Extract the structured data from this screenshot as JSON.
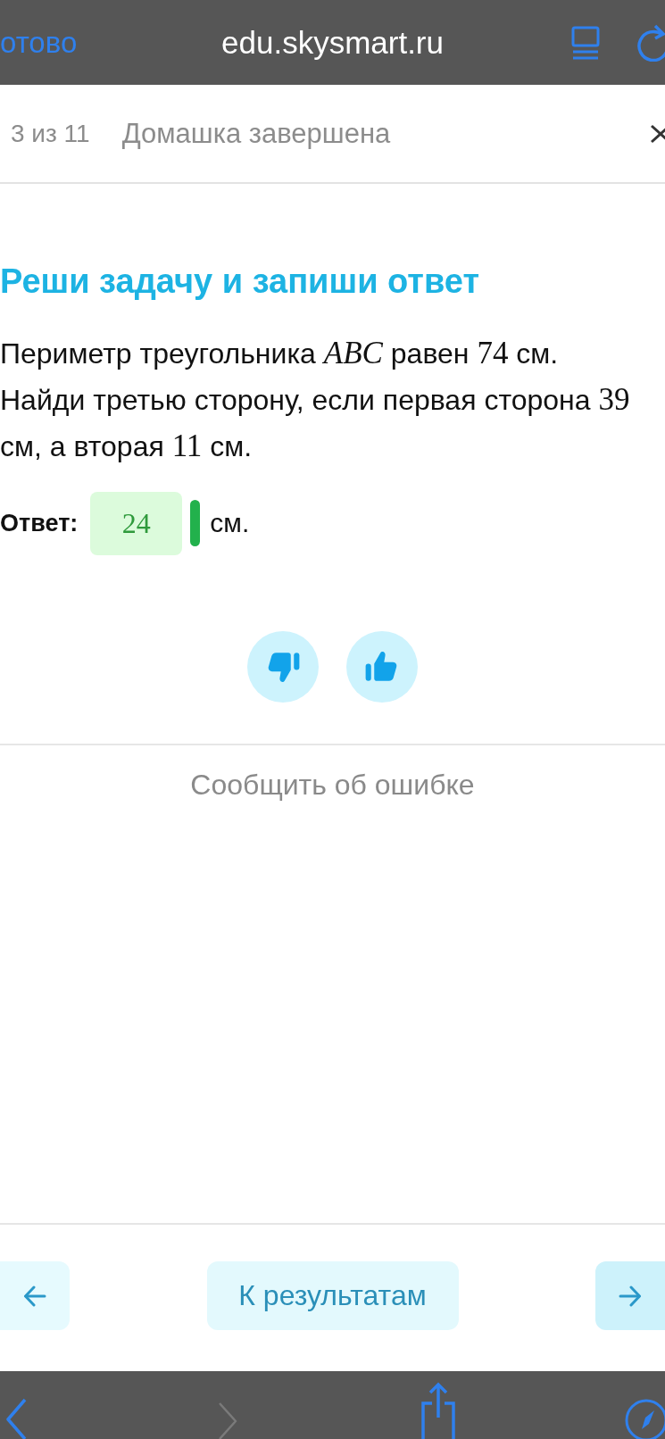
{
  "browser_bar": {
    "done": "отово",
    "url": "edu.skysmart.ru"
  },
  "header": {
    "progress": "3 из 11",
    "status": "Домашка завершена"
  },
  "task": {
    "title": "Реши задачу и запиши ответ",
    "lines": [
      [
        {
          "kind": "text",
          "text": "Периметр треугольника "
        },
        {
          "kind": "math",
          "text": "*ABC*"
        },
        {
          "kind": "text",
          "text": " равен "
        },
        {
          "kind": "math",
          "text": "74"
        },
        {
          "kind": "text",
          "text": " см."
        }
      ],
      [
        {
          "kind": "text",
          "text": "Найди третью сторону, если первая сторона "
        },
        {
          "kind": "math",
          "text": "39"
        }
      ],
      [
        {
          "kind": "text",
          "text": "см, а вторая "
        },
        {
          "kind": "math",
          "text": "11"
        },
        {
          "kind": "text",
          "text": " см."
        }
      ]
    ],
    "answer": {
      "label": "Ответ:",
      "value": "24",
      "correct": true,
      "unit": "см."
    }
  },
  "feedback": {
    "buttons": [
      {
        "kind": "dislike"
      },
      {
        "kind": "like"
      }
    ],
    "report": "Сообщить об ошибке"
  },
  "navigation": {
    "buttons": [
      {
        "kind": "prev"
      },
      {
        "kind": "results",
        "label": "К результатам"
      },
      {
        "kind": "next"
      }
    ]
  },
  "toolbar": {
    "items": [
      {
        "kind": "back",
        "disabled": false
      },
      {
        "kind": "forward",
        "disabled": true
      },
      {
        "kind": "share",
        "disabled": false
      },
      {
        "kind": "compass",
        "disabled": false
      }
    ]
  }
}
